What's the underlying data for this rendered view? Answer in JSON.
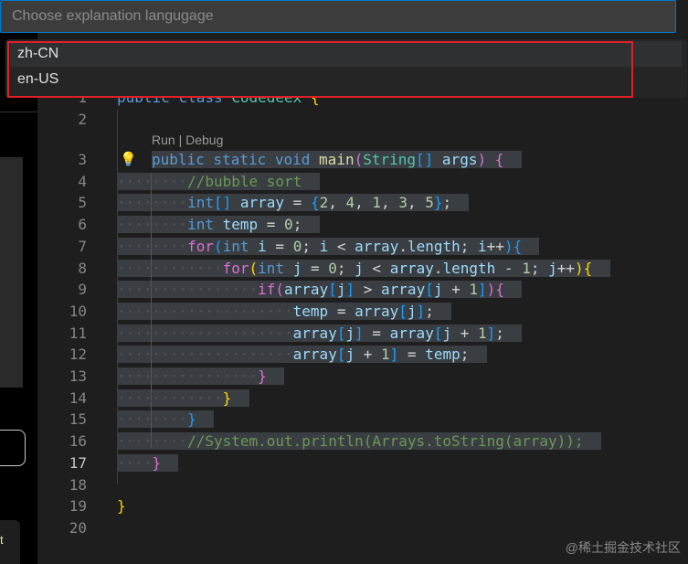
{
  "picker": {
    "placeholder": "Choose explanation langugage",
    "options": [
      "zh-CN",
      "en-US"
    ],
    "active": 0
  },
  "left_panel": {
    "partial_text": "t"
  },
  "editor": {
    "codelens": "Run | Debug",
    "current_line": 17,
    "selection": [
      3,
      17
    ],
    "lines": [
      [
        [
          "public",
          "kw"
        ],
        [
          " ",
          "op"
        ],
        [
          "class",
          "kw"
        ],
        [
          " ",
          "op"
        ],
        [
          "Codedeex",
          "ty"
        ],
        [
          " ",
          "op"
        ],
        [
          "{",
          "b1"
        ]
      ],
      [],
      [
        [
          "public",
          "kw"
        ],
        [
          " ",
          "op"
        ],
        [
          "static",
          "kw"
        ],
        [
          " ",
          "op"
        ],
        [
          "void",
          "kw"
        ],
        [
          " ",
          "op"
        ],
        [
          "main",
          "fn"
        ],
        [
          "(",
          "b2"
        ],
        [
          "String",
          "ty"
        ],
        [
          "[]",
          "b3"
        ],
        [
          " ",
          "op"
        ],
        [
          "args",
          "va"
        ],
        [
          ")",
          "b2"
        ],
        [
          " ",
          "op"
        ],
        [
          "{",
          "b2"
        ]
      ],
      [
        [
          "        ",
          "op"
        ],
        [
          "//bubble sort",
          "cm"
        ]
      ],
      [
        [
          "        ",
          "op"
        ],
        [
          "int",
          "kw"
        ],
        [
          "[]",
          "b3"
        ],
        [
          " ",
          "op"
        ],
        [
          "array",
          "va"
        ],
        [
          " = ",
          "op"
        ],
        [
          "{",
          "b3"
        ],
        [
          "2",
          "nu"
        ],
        [
          ", ",
          "op"
        ],
        [
          "4",
          "nu"
        ],
        [
          ", ",
          "op"
        ],
        [
          "1",
          "nu"
        ],
        [
          ", ",
          "op"
        ],
        [
          "3",
          "nu"
        ],
        [
          ", ",
          "op"
        ],
        [
          "5",
          "nu"
        ],
        [
          "}",
          "b3"
        ],
        [
          ";",
          "op"
        ]
      ],
      [
        [
          "        ",
          "op"
        ],
        [
          "int",
          "kw"
        ],
        [
          " ",
          "op"
        ],
        [
          "temp",
          "va"
        ],
        [
          " = ",
          "op"
        ],
        [
          "0",
          "nu"
        ],
        [
          ";",
          "op"
        ]
      ],
      [
        [
          "        ",
          "op"
        ],
        [
          "for",
          "b2"
        ],
        [
          "(",
          "b3"
        ],
        [
          "int",
          "kw"
        ],
        [
          " ",
          "op"
        ],
        [
          "i",
          "va"
        ],
        [
          " = ",
          "op"
        ],
        [
          "0",
          "nu"
        ],
        [
          "; ",
          "op"
        ],
        [
          "i",
          "va"
        ],
        [
          " < ",
          "op"
        ],
        [
          "array",
          "va"
        ],
        [
          ".",
          "op"
        ],
        [
          "length",
          "va"
        ],
        [
          "; ",
          "op"
        ],
        [
          "i",
          "va"
        ],
        [
          "++",
          "op"
        ],
        [
          ")",
          "b3"
        ],
        [
          "{",
          "b3"
        ]
      ],
      [
        [
          "            ",
          "op"
        ],
        [
          "for",
          "b2"
        ],
        [
          "(",
          "b1"
        ],
        [
          "int",
          "kw"
        ],
        [
          " ",
          "op"
        ],
        [
          "j",
          "va"
        ],
        [
          " = ",
          "op"
        ],
        [
          "0",
          "nu"
        ],
        [
          "; ",
          "op"
        ],
        [
          "j",
          "va"
        ],
        [
          " < ",
          "op"
        ],
        [
          "array",
          "va"
        ],
        [
          ".",
          "op"
        ],
        [
          "length",
          "va"
        ],
        [
          " - ",
          "op"
        ],
        [
          "1",
          "nu"
        ],
        [
          "; ",
          "op"
        ],
        [
          "j",
          "va"
        ],
        [
          "++",
          "op"
        ],
        [
          ")",
          "b1"
        ],
        [
          "{",
          "b1"
        ]
      ],
      [
        [
          "                ",
          "op"
        ],
        [
          "if",
          "b2"
        ],
        [
          "(",
          "b2"
        ],
        [
          "array",
          "va"
        ],
        [
          "[",
          "b3"
        ],
        [
          "j",
          "va"
        ],
        [
          "]",
          "b3"
        ],
        [
          " > ",
          "op"
        ],
        [
          "array",
          "va"
        ],
        [
          "[",
          "b3"
        ],
        [
          "j",
          "va"
        ],
        [
          " + ",
          "op"
        ],
        [
          "1",
          "nu"
        ],
        [
          "]",
          "b3"
        ],
        [
          ")",
          "b2"
        ],
        [
          "{",
          "b2"
        ]
      ],
      [
        [
          "                    ",
          "op"
        ],
        [
          "temp",
          "va"
        ],
        [
          " = ",
          "op"
        ],
        [
          "array",
          "va"
        ],
        [
          "[",
          "b3"
        ],
        [
          "j",
          "va"
        ],
        [
          "]",
          "b3"
        ],
        [
          ";",
          "op"
        ]
      ],
      [
        [
          "                    ",
          "op"
        ],
        [
          "array",
          "va"
        ],
        [
          "[",
          "b3"
        ],
        [
          "j",
          "va"
        ],
        [
          "]",
          "b3"
        ],
        [
          " = ",
          "op"
        ],
        [
          "array",
          "va"
        ],
        [
          "[",
          "b3"
        ],
        [
          "j",
          "va"
        ],
        [
          " + ",
          "op"
        ],
        [
          "1",
          "nu"
        ],
        [
          "]",
          "b3"
        ],
        [
          ";",
          "op"
        ]
      ],
      [
        [
          "                    ",
          "op"
        ],
        [
          "array",
          "va"
        ],
        [
          "[",
          "b3"
        ],
        [
          "j",
          "va"
        ],
        [
          " + ",
          "op"
        ],
        [
          "1",
          "nu"
        ],
        [
          "]",
          "b3"
        ],
        [
          " = ",
          "op"
        ],
        [
          "temp",
          "va"
        ],
        [
          ";",
          "op"
        ]
      ],
      [
        [
          "                ",
          "op"
        ],
        [
          "}",
          "b2"
        ]
      ],
      [
        [
          "            ",
          "op"
        ],
        [
          "}",
          "b1"
        ]
      ],
      [
        [
          "        ",
          "op"
        ],
        [
          "}",
          "b3"
        ]
      ],
      [
        [
          "        ",
          "op"
        ],
        [
          "//System.out.println(Arrays.toString(array));",
          "cm"
        ]
      ],
      [
        [
          "    ",
          "op"
        ],
        [
          "}",
          "b2"
        ]
      ],
      [],
      [
        [
          "}",
          "b1"
        ]
      ],
      []
    ]
  },
  "watermark": "@稀土掘金技术社区"
}
